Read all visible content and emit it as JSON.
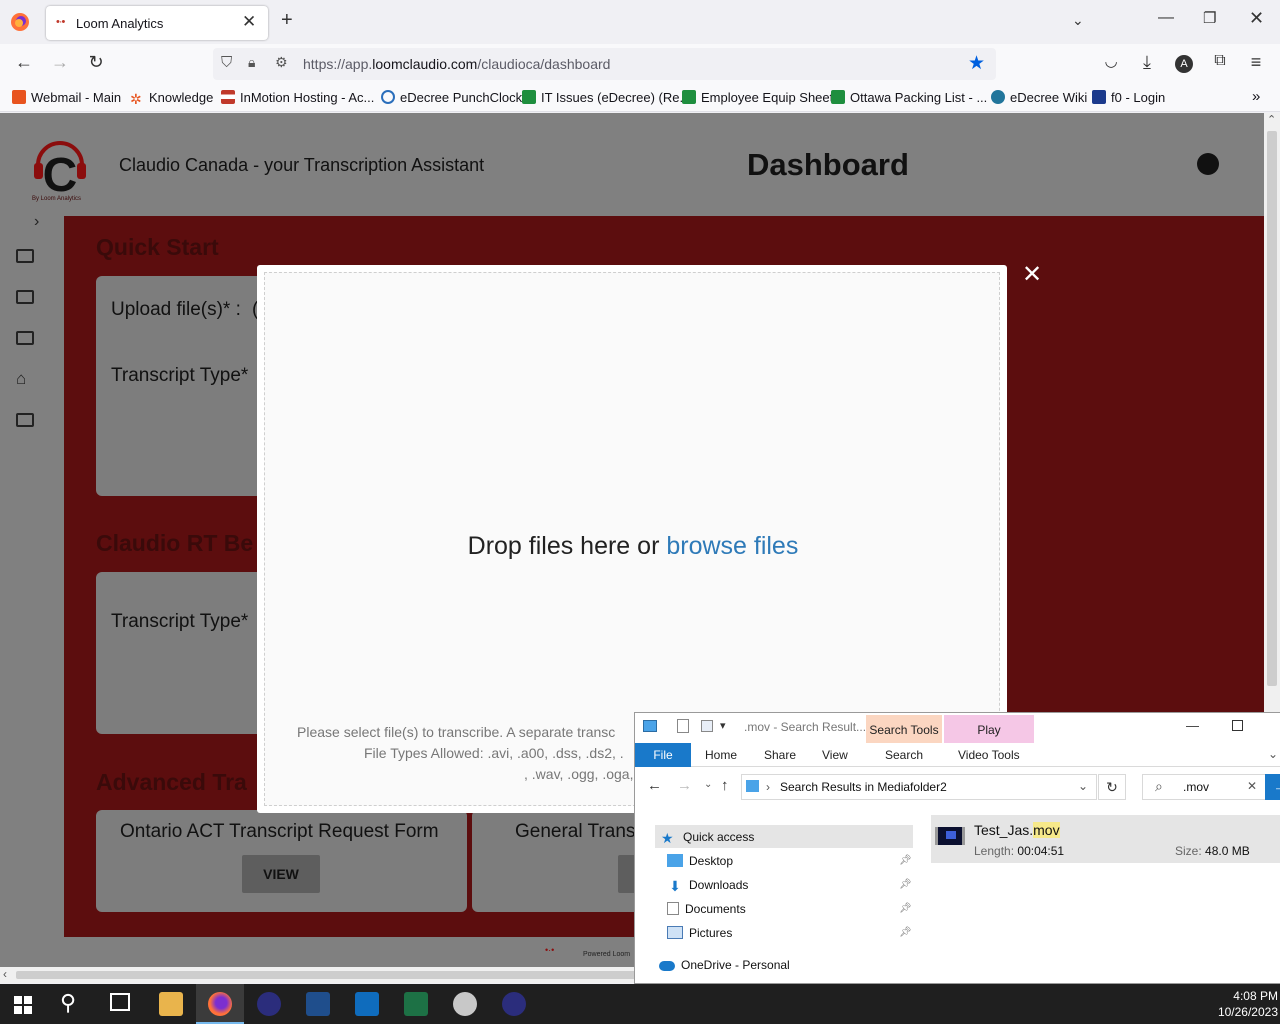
{
  "browser": {
    "tab_title": "Loom Analytics",
    "url_prefix": "https://app.",
    "url_domain": "loomclaudio.com",
    "url_path": "/claudioca/dashboard"
  },
  "bookmarks": [
    "Webmail - Main",
    "Knowledge",
    "InMotion Hosting - Ac...",
    "eDecree PunchClock",
    "IT Issues (eDecree) (Re...",
    "Employee Equip Sheet",
    "Ottawa Packing List - ...",
    "eDecree Wiki",
    "f0 - Login"
  ],
  "app": {
    "logo_tagline": "By Loom Analytics",
    "brand_title": "Claudio Canada - your Transcription Assistant",
    "page_title": "Dashboard",
    "sections": {
      "quick_start": "Quick Start",
      "claudio_rt": "Claudio RT Be",
      "advanced": "Advanced Tra"
    },
    "labels": {
      "upload": "Upload file(s)* :",
      "upload_trail": "(",
      "transcript_type": "Transcript Type*",
      "transcript_type_2": "Transcript Type*"
    },
    "cards": {
      "ontario": "Ontario ACT Transcript Request Form",
      "general": "General Trans",
      "view": "VIEW"
    },
    "powered": "Powered Loom"
  },
  "modal": {
    "drop_text": "Drop files here or",
    "browse_link": "browse files",
    "hint_line1": "Please select file(s) to transcribe.  A separate transc",
    "hint_line2": "File Types Allowed: .avi, .a00, .dss, .ds2, .",
    "hint_line3": ", .wav, .ogg, .oga,",
    "close": "✕"
  },
  "explorer": {
    "title": ".mov - Search Result...",
    "context_tab_search_tools": "Search Tools",
    "context_tab_play": "Play",
    "ribbon_tabs": [
      "File",
      "Home",
      "Share",
      "View",
      "Search",
      "Video Tools"
    ],
    "address": "Search Results in Mediafolder2",
    "search_value": ".mov",
    "nav": [
      "Quick access",
      "Desktop",
      "Downloads",
      "Documents",
      "Pictures",
      "OneDrive - Personal"
    ],
    "result": {
      "name_base": "Test_Jas.",
      "name_ext": "mov",
      "length_label": "Length:",
      "length": "00:04:51",
      "size_label": "Size:",
      "size": "48.0 MB"
    }
  },
  "taskbar": {
    "time": "4:08 PM",
    "date": "10/26/2023"
  }
}
